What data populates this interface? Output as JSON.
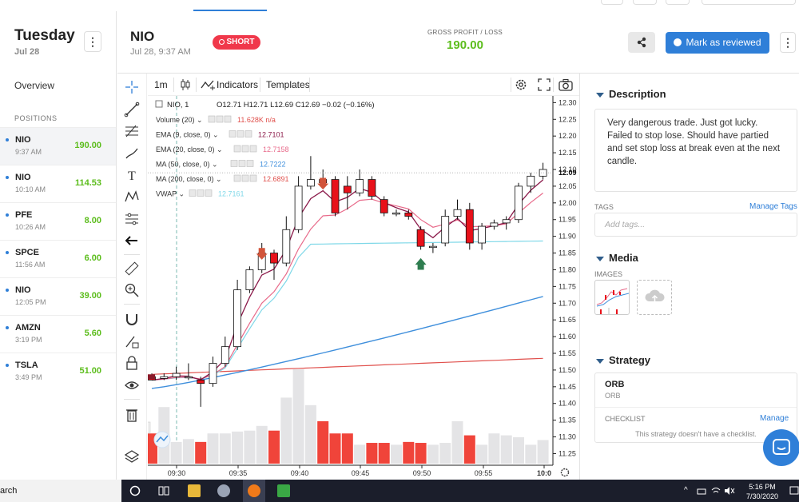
{
  "sidebar": {
    "day": "Tuesday",
    "date": "Jul 28",
    "overview": "Overview",
    "positions_header": "POSITIONS",
    "positions": [
      {
        "symbol": "NIO",
        "time": "9:37 AM",
        "pl": "190.00"
      },
      {
        "symbol": "NIO",
        "time": "10:10 AM",
        "pl": "114.53"
      },
      {
        "symbol": "PFE",
        "time": "10:26 AM",
        "pl": "8.00"
      },
      {
        "symbol": "SPCE",
        "time": "11:56 AM",
        "pl": "6.00"
      },
      {
        "symbol": "NIO",
        "time": "12:05 PM",
        "pl": "39.00"
      },
      {
        "symbol": "AMZN",
        "time": "3:19 PM",
        "pl": "5.60"
      },
      {
        "symbol": "TSLA",
        "time": "3:49 PM",
        "pl": "51.00"
      }
    ]
  },
  "header": {
    "symbol": "NIO",
    "datetime": "Jul 28, 9:37 AM",
    "side_badge": "SHORT",
    "gross_label": "GROSS PROFIT / LOSS",
    "gross_value": "190.00",
    "review_button": "Mark as reviewed"
  },
  "chart_toolbar": {
    "interval": "1m",
    "indicators": "Indicators",
    "templates": "Templates"
  },
  "legend": {
    "symbol": "NIO, 1",
    "ohlc": "O12.71 H12.71 L12.69 C12.69 −0.02 (−0.16%)",
    "rows": [
      {
        "label": "Volume (20)",
        "value": "11.628K n/a",
        "color": "#e0504c"
      },
      {
        "label": "EMA (9, close, 0)",
        "value": "12.7101",
        "color": "#8b1a4a"
      },
      {
        "label": "EMA (20, close, 0)",
        "value": "12.7158",
        "color": "#e86a8a"
      },
      {
        "label": "MA (50, close, 0)",
        "value": "12.7222",
        "color": "#3f8fdc"
      },
      {
        "label": "MA (200, close, 0)",
        "value": "12.6891",
        "color": "#e0504c"
      },
      {
        "label": "VWAP",
        "value": "12.7161",
        "color": "#7fd8e8"
      }
    ]
  },
  "chart_data": {
    "type": "candlestick",
    "symbol": "NIO",
    "interval": "1m",
    "x_ticks": [
      "09:30",
      "09:35",
      "09:40",
      "09:45",
      "09:50",
      "09:55",
      "10:0"
    ],
    "y_ticks": [
      "12.30",
      "12.25",
      "12.20",
      "12.15",
      "12.10",
      "12.05",
      "12.00",
      "11.95",
      "11.90",
      "11.85",
      "11.80",
      "11.75",
      "11.70",
      "11.65",
      "11.60",
      "11.55",
      "11.50",
      "11.45",
      "11.40",
      "11.35",
      "11.30",
      "11.25"
    ],
    "last_price_label": "12.09",
    "ylim": [
      11.22,
      12.32
    ],
    "candles": [
      {
        "o": 11.48,
        "h": 11.49,
        "l": 11.47,
        "c": 11.47
      },
      {
        "o": 11.475,
        "h": 11.49,
        "l": 11.47,
        "c": 11.48
      },
      {
        "o": 11.48,
        "h": 11.51,
        "l": 11.47,
        "c": 11.49
      },
      {
        "o": 11.48,
        "h": 11.52,
        "l": 11.47,
        "c": 11.48
      },
      {
        "o": 11.47,
        "h": 11.48,
        "l": 11.39,
        "c": 11.46
      },
      {
        "o": 11.46,
        "h": 11.54,
        "l": 11.45,
        "c": 11.52
      },
      {
        "o": 11.52,
        "h": 11.6,
        "l": 11.51,
        "c": 11.57
      },
      {
        "o": 11.57,
        "h": 11.77,
        "l": 11.56,
        "c": 11.74
      },
      {
        "o": 11.74,
        "h": 11.81,
        "l": 11.73,
        "c": 11.8
      },
      {
        "o": 11.8,
        "h": 11.88,
        "l": 11.79,
        "c": 11.85
      },
      {
        "o": 11.85,
        "h": 11.86,
        "l": 11.77,
        "c": 11.82
      },
      {
        "o": 11.82,
        "h": 11.96,
        "l": 11.81,
        "c": 11.92
      },
      {
        "o": 11.92,
        "h": 12.08,
        "l": 11.91,
        "c": 12.05
      },
      {
        "o": 12.05,
        "h": 12.14,
        "l": 12.04,
        "c": 12.07
      },
      {
        "o": 12.07,
        "h": 12.1,
        "l": 12.05,
        "c": 12.06
      },
      {
        "o": 12.07,
        "h": 12.08,
        "l": 11.96,
        "c": 11.97
      },
      {
        "o": 12.05,
        "h": 12.08,
        "l": 11.98,
        "c": 12.03
      },
      {
        "o": 12.03,
        "h": 12.1,
        "l": 12.02,
        "c": 12.07
      },
      {
        "o": 12.07,
        "h": 12.08,
        "l": 12.01,
        "c": 12.02
      },
      {
        "o": 12.01,
        "h": 12.02,
        "l": 11.96,
        "c": 11.97
      },
      {
        "o": 11.97,
        "h": 11.98,
        "l": 11.96,
        "c": 11.97
      },
      {
        "o": 11.97,
        "h": 11.98,
        "l": 11.95,
        "c": 11.96
      },
      {
        "o": 11.92,
        "h": 11.93,
        "l": 11.86,
        "c": 11.87
      },
      {
        "o": 11.87,
        "h": 11.88,
        "l": 11.85,
        "c": 11.87
      },
      {
        "o": 11.88,
        "h": 11.98,
        "l": 11.87,
        "c": 11.96
      },
      {
        "o": 11.96,
        "h": 12.01,
        "l": 11.95,
        "c": 11.98
      },
      {
        "o": 11.98,
        "h": 12.0,
        "l": 11.86,
        "c": 11.88
      },
      {
        "o": 11.88,
        "h": 11.94,
        "l": 11.86,
        "c": 11.93
      },
      {
        "o": 11.93,
        "h": 11.95,
        "l": 11.92,
        "c": 11.94
      },
      {
        "o": 11.94,
        "h": 11.96,
        "l": 11.92,
        "c": 11.95
      },
      {
        "o": 11.95,
        "h": 12.06,
        "l": 11.94,
        "c": 12.05
      },
      {
        "o": 12.05,
        "h": 12.09,
        "l": 12.03,
        "c": 12.08
      },
      {
        "o": 12.08,
        "h": 12.12,
        "l": 12.07,
        "c": 12.1
      }
    ],
    "volume": [
      0.32,
      0.6,
      0.23,
      0.26,
      0.23,
      0.32,
      0.32,
      0.34,
      0.35,
      0.4,
      0.35,
      0.7,
      1.0,
      0.62,
      0.45,
      0.32,
      0.32,
      0.2,
      0.22,
      0.22,
      0.2,
      0.23,
      0.22,
      0.2,
      0.22,
      0.45,
      0.3,
      0.2,
      0.32,
      0.3,
      0.28,
      0.2,
      0.25
    ]
  },
  "description": {
    "title": "Description",
    "text": "Very dangerous trade. Just got lucky. Failed to stop lose. Should have partied and set stop loss at break even at the next candle.",
    "tags_label": "TAGS",
    "manage_tags": "Manage Tags",
    "tags_placeholder": "Add tags..."
  },
  "media": {
    "title": "Media",
    "images_label": "IMAGES"
  },
  "strategy": {
    "title": "Strategy",
    "name": "ORB",
    "subname": "ORB",
    "checklist_label": "CHECKLIST",
    "manage": "Manage",
    "empty_msg": "This strategy doesn't have a checklist."
  },
  "taskbar": {
    "search": "arch",
    "time": "5:16 PM",
    "date": "7/30/2020"
  },
  "colors": {
    "accent": "#2f7fd8",
    "profit": "#5cbd1c",
    "short_badge": "#f0384b",
    "bull": "#ffffff",
    "bear": "#e8111a"
  }
}
